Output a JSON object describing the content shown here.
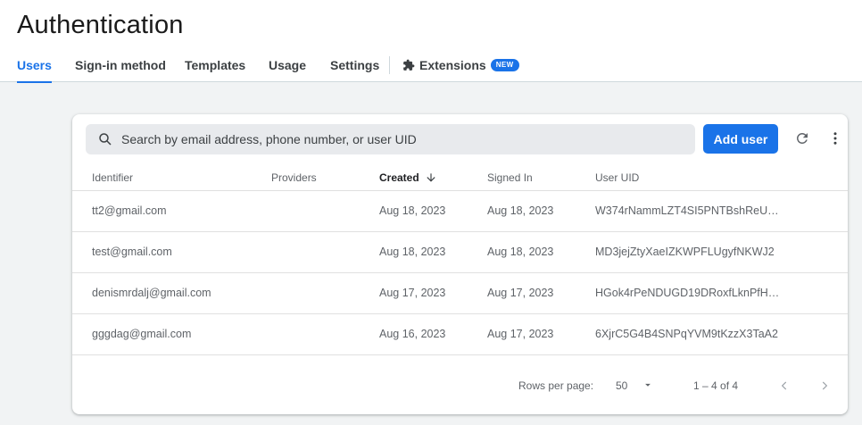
{
  "page": {
    "title": "Authentication"
  },
  "tabs": [
    {
      "label": "Users",
      "active": true
    },
    {
      "label": "Sign-in method"
    },
    {
      "label": "Templates"
    },
    {
      "label": "Usage"
    },
    {
      "label": "Settings"
    },
    {
      "label": "Extensions",
      "icon": "puzzle-icon",
      "badge": "NEW"
    }
  ],
  "toolbar": {
    "search_placeholder": "Search by email address, phone number, or user UID",
    "add_user_label": "Add user",
    "refresh_icon": "refresh-icon",
    "more_icon": "more-vert-icon"
  },
  "table": {
    "columns": [
      "Identifier",
      "Providers",
      "Created",
      "Signed In",
      "User UID"
    ],
    "sort_column": "Created",
    "rows": [
      {
        "identifier": "tt2@gmail.com",
        "providers": "",
        "created": "Aug 18, 2023",
        "signed_in": "Aug 18, 2023",
        "uid": "W374rNammLZT4SI5PNTBshReU…"
      },
      {
        "identifier": "test@gmail.com",
        "providers": "",
        "created": "Aug 18, 2023",
        "signed_in": "Aug 18, 2023",
        "uid": "MD3jejZtyXaeIZKWPFLUgyfNKWJ2"
      },
      {
        "identifier": "denismrdalj@gmail.com",
        "providers": "",
        "created": "Aug 17, 2023",
        "signed_in": "Aug 17, 2023",
        "uid": "HGok4rPeNDUGD19DRoxfLknPfH…"
      },
      {
        "identifier": "gggdag@gmail.com",
        "providers": "",
        "created": "Aug 16, 2023",
        "signed_in": "Aug 17, 2023",
        "uid": "6XjrC5G4B4SNPqYVM9tKzzX3TaA2"
      }
    ]
  },
  "pagination": {
    "rows_per_page_label": "Rows per page:",
    "rows_per_page_value": "50",
    "range_label": "1 – 4 of 4"
  },
  "colors": {
    "accent": "#1a73e8",
    "background": "#f1f3f4"
  }
}
